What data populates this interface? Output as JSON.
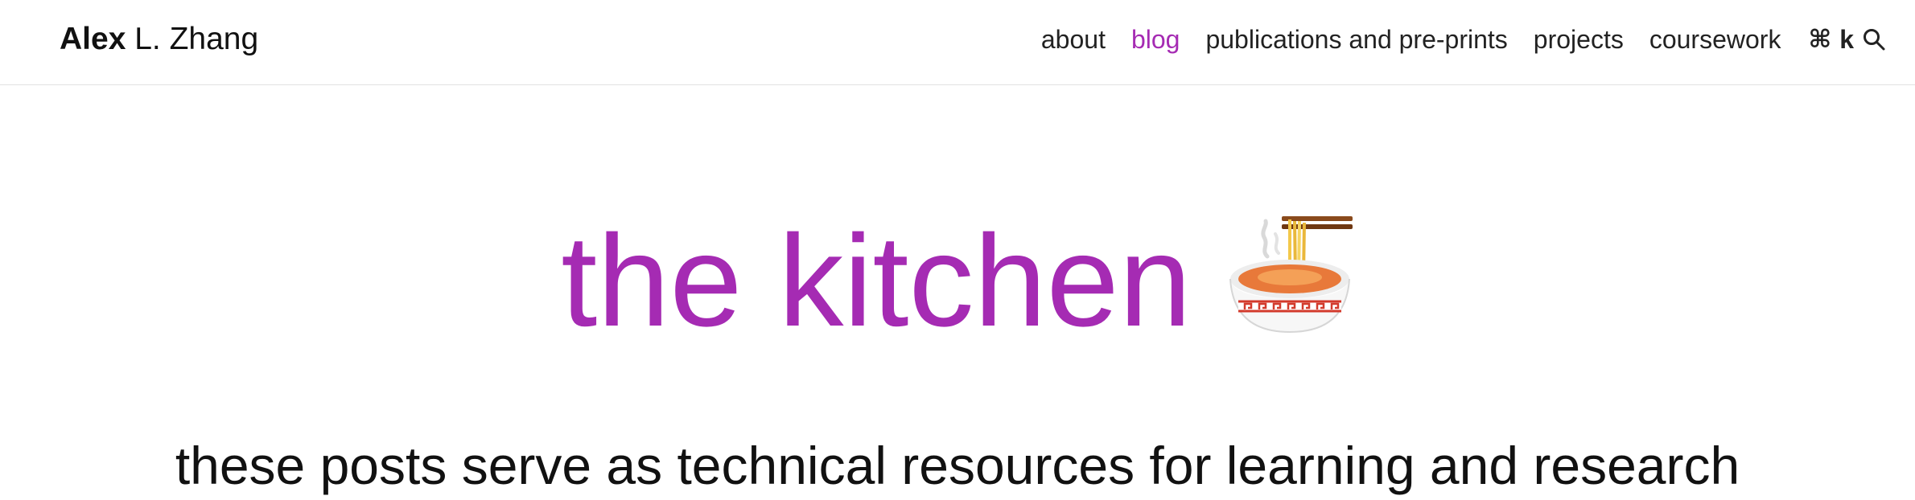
{
  "brand": {
    "first": "Alex",
    "rest": " L. Zhang"
  },
  "nav": {
    "items": [
      {
        "label": "about",
        "active": false
      },
      {
        "label": "blog",
        "active": true
      },
      {
        "label": "publications and pre-prints",
        "active": false
      },
      {
        "label": "projects",
        "active": false
      },
      {
        "label": "coursework",
        "active": false
      }
    ],
    "shortcut": {
      "cmd_symbol": "⌘",
      "key": "k",
      "icon": "search-icon"
    }
  },
  "hero": {
    "title": "the kitchen",
    "emoji_icon": "ramen-bowl-icon",
    "subtitle": "these posts serve as technical resources for learning and research"
  },
  "colors": {
    "accent": "#a52bb3",
    "text": "#111111",
    "divider": "#e2e2e2"
  }
}
